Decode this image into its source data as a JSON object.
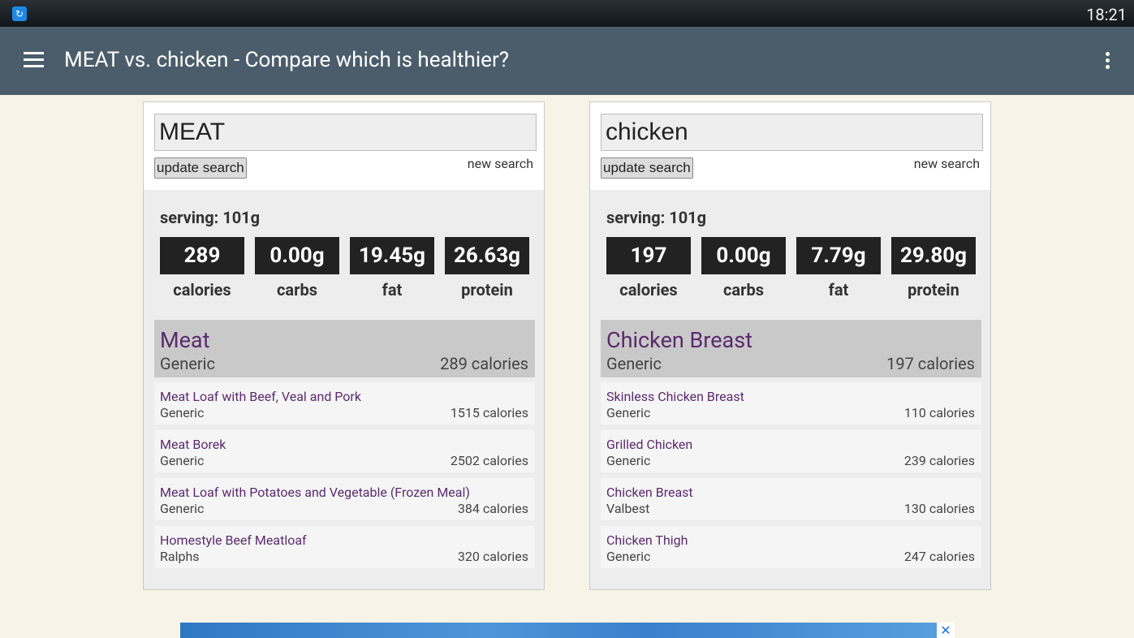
{
  "status_bar": {
    "time": "18:21",
    "app_icon": "app-badge-icon"
  },
  "app_bar": {
    "title": "MEAT vs. chicken - Compare which is healthier?"
  },
  "left": {
    "query": "MEAT",
    "update_label": "update search",
    "new_search_label": "new search",
    "serving": "serving: 101g",
    "stats": [
      {
        "value": "289",
        "label": "calories"
      },
      {
        "value": "0.00g",
        "label": "carbs"
      },
      {
        "value": "19.45g",
        "label": "fat"
      },
      {
        "value": "26.63g",
        "label": "protein"
      }
    ],
    "main": {
      "name": "Meat",
      "brand": "Generic",
      "calories": "289 calories"
    },
    "items": [
      {
        "name": "Meat Loaf with Beef, Veal and Pork",
        "brand": "Generic",
        "calories": "1515 calories"
      },
      {
        "name": "Meat Borek",
        "brand": "Generic",
        "calories": "2502 calories"
      },
      {
        "name": "Meat Loaf with Potatoes and Vegetable (Frozen Meal)",
        "brand": "Generic",
        "calories": "384 calories"
      },
      {
        "name": "Homestyle Beef Meatloaf",
        "brand": "Ralphs",
        "calories": "320 calories"
      }
    ]
  },
  "right": {
    "query": "chicken",
    "update_label": "update search",
    "new_search_label": "new search",
    "serving": "serving: 101g",
    "stats": [
      {
        "value": "197",
        "label": "calories"
      },
      {
        "value": "0.00g",
        "label": "carbs"
      },
      {
        "value": "7.79g",
        "label": "fat"
      },
      {
        "value": "29.80g",
        "label": "protein"
      }
    ],
    "main": {
      "name": "Chicken Breast",
      "brand": "Generic",
      "calories": "197 calories"
    },
    "items": [
      {
        "name": "Skinless Chicken Breast",
        "brand": "Generic",
        "calories": "110 calories"
      },
      {
        "name": "Grilled Chicken",
        "brand": "Generic",
        "calories": "239 calories"
      },
      {
        "name": "Chicken Breast",
        "brand": "Valbest",
        "calories": "130 calories"
      },
      {
        "name": "Chicken Thigh",
        "brand": "Generic",
        "calories": "247 calories"
      }
    ]
  },
  "ad": {
    "close_icon": "close-icon"
  }
}
